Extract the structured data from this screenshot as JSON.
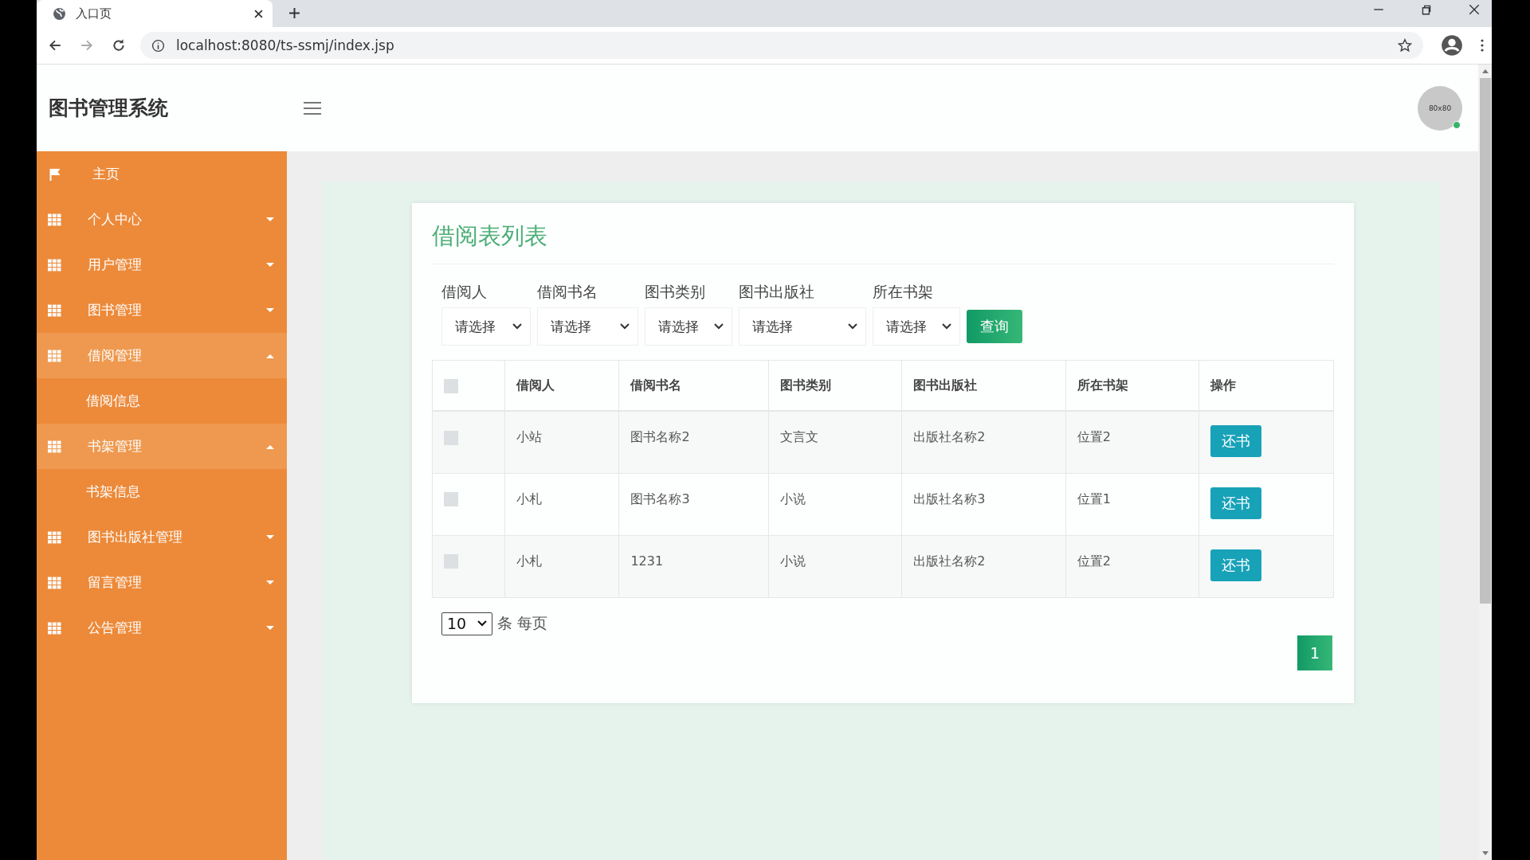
{
  "browser": {
    "tab_title": "入口页",
    "url": "localhost:8080/ts-ssmj/index.jsp"
  },
  "header": {
    "title": "图书管理系统",
    "avatar_text": "80x80"
  },
  "sidebar": {
    "items": [
      {
        "label": "主页",
        "kind": "home",
        "expanded": false
      },
      {
        "label": "个人中心",
        "kind": "menu",
        "expanded": false
      },
      {
        "label": "用户管理",
        "kind": "menu",
        "expanded": false
      },
      {
        "label": "图书管理",
        "kind": "menu",
        "expanded": false
      },
      {
        "label": "借阅管理",
        "kind": "menu",
        "expanded": true,
        "children": [
          {
            "label": "借阅信息"
          }
        ]
      },
      {
        "label": "书架管理",
        "kind": "menu",
        "expanded": true,
        "children": [
          {
            "label": "书架信息"
          }
        ]
      },
      {
        "label": "图书出版社管理",
        "kind": "menu",
        "expanded": false
      },
      {
        "label": "留言管理",
        "kind": "menu",
        "expanded": false
      },
      {
        "label": "公告管理",
        "kind": "menu",
        "expanded": false
      }
    ]
  },
  "card": {
    "title": "借阅表列表",
    "filters": [
      {
        "label": "借阅人",
        "value": "请选择"
      },
      {
        "label": "借阅书名",
        "value": "请选择"
      },
      {
        "label": "图书类别",
        "value": "请选择"
      },
      {
        "label": "图书出版社",
        "value": "请选择"
      },
      {
        "label": "所在书架",
        "value": "请选择"
      }
    ],
    "query_button": "查询",
    "table": {
      "all_checked": false,
      "columns": [
        "借阅人",
        "借阅书名",
        "图书类别",
        "图书出版社",
        "所在书架",
        "操作"
      ],
      "rows": [
        {
          "checked": false,
          "cells": [
            "小站",
            "图书名称2",
            "文言文",
            "出版社名称2",
            "位置2"
          ],
          "action": "还书"
        },
        {
          "checked": false,
          "cells": [
            "小札",
            "图书名称3",
            "小说",
            "出版社名称3",
            "位置1"
          ],
          "action": "还书"
        },
        {
          "checked": false,
          "cells": [
            "小札",
            "1231",
            "小说",
            "出版社名称2",
            "位置2"
          ],
          "action": "还书"
        }
      ]
    },
    "page_size": "10",
    "per_page_label": "条 每页",
    "pages": [
      {
        "label": "1",
        "selected": true
      }
    ]
  }
}
